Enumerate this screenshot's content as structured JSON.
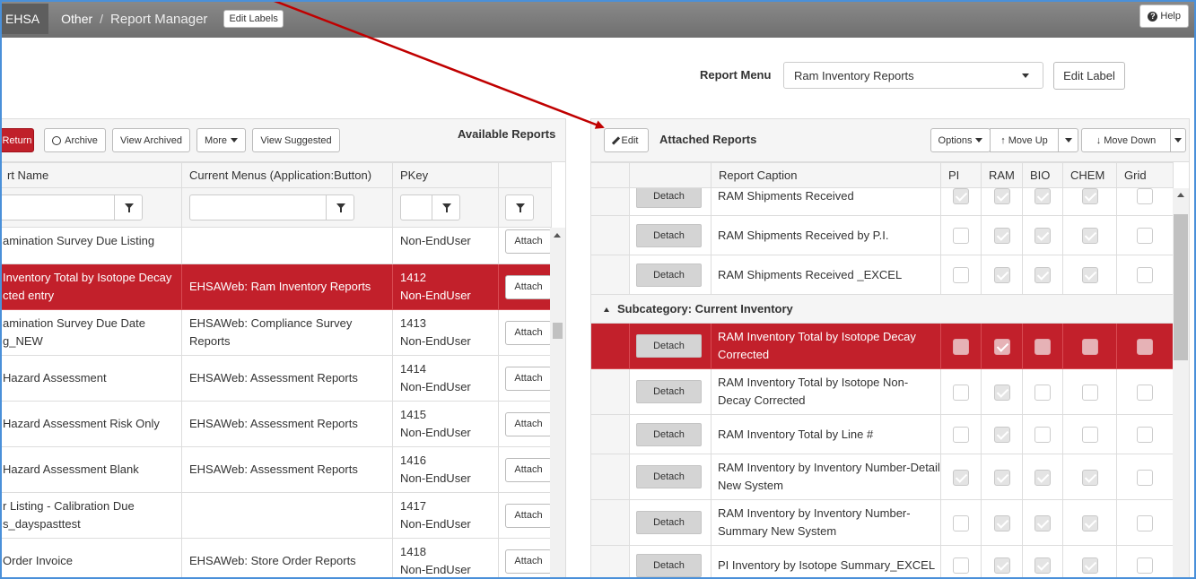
{
  "topbar": {
    "brand": "EHSA",
    "crumbs": [
      "Other",
      "/",
      "Report Manager"
    ],
    "edit_labels": "Edit Labels",
    "help": "Help"
  },
  "report_menu": {
    "label": "Report Menu",
    "selected": "Ram Inventory Reports",
    "edit_label": "Edit Label"
  },
  "left": {
    "buttons": {
      "return": "Return",
      "archive": "Archive",
      "view_archived": "View Archived",
      "more": "More",
      "view_suggested": "View Suggested"
    },
    "title": "Available Reports",
    "columns": [
      "rt Name",
      "Current Menus (Application:Button)",
      "PKey"
    ],
    "attach_label": "Attach",
    "rows": [
      {
        "name1": "amination Survey Due Listing",
        "name2": "",
        "menu1": "",
        "menu2": "",
        "pkey1": "",
        "pkey2": "Non-EndUser"
      },
      {
        "name1": "Inventory Total by Isotope Decay",
        "name2": "cted entry",
        "menu1": "EHSAWeb: Ram Inventory Reports",
        "menu2": "",
        "pkey1": "1412",
        "pkey2": "Non-EndUser"
      },
      {
        "name1": "amination Survey Due Date",
        "name2": "g_NEW",
        "menu1": "EHSAWeb: Compliance Survey",
        "menu2": "Reports",
        "pkey1": "1413",
        "pkey2": "Non-EndUser"
      },
      {
        "name1": "Hazard Assessment",
        "name2": "",
        "menu1": "EHSAWeb: Assessment Reports",
        "menu2": "",
        "pkey1": "1414",
        "pkey2": "Non-EndUser"
      },
      {
        "name1": "Hazard Assessment Risk Only",
        "name2": "",
        "menu1": "EHSAWeb: Assessment Reports",
        "menu2": "",
        "pkey1": "1415",
        "pkey2": "Non-EndUser"
      },
      {
        "name1": "Hazard Assessment Blank",
        "name2": "",
        "menu1": "EHSAWeb: Assessment Reports",
        "menu2": "",
        "pkey1": "1416",
        "pkey2": "Non-EndUser"
      },
      {
        "name1": "r Listing - Calibration Due",
        "name2": "s_dayspasttest",
        "menu1": "",
        "menu2": "",
        "pkey1": "1417",
        "pkey2": "Non-EndUser"
      },
      {
        "name1": "Order Invoice",
        "name2": "",
        "menu1": "EHSAWeb: Store Order Reports",
        "menu2": "",
        "pkey1": "1418",
        "pkey2": "Non-EndUser"
      }
    ]
  },
  "right": {
    "edit": "Edit",
    "title": "Attached Reports",
    "options": "Options",
    "move_up": "Move Up",
    "move_down": "Move Down",
    "columns": [
      "Report Caption",
      "PI",
      "RAM",
      "BIO",
      "CHEM",
      "Grid"
    ],
    "detach_label": "Detach",
    "subcategory": "Subcategory: Current Inventory",
    "rows_before": [
      {
        "cap1": "RAM Shipments Received",
        "cap2": "",
        "checks": [
          true,
          true,
          true,
          true,
          false
        ]
      },
      {
        "cap1": "RAM Shipments Received by P.I.",
        "cap2": "",
        "checks": [
          false,
          true,
          true,
          true,
          false
        ]
      },
      {
        "cap1": "RAM Shipments Received _EXCEL",
        "cap2": "",
        "checks": [
          false,
          true,
          true,
          true,
          false
        ]
      }
    ],
    "rows_after": [
      {
        "cap1": "RAM Inventory Total by Isotope Decay",
        "cap2": "Corrected",
        "checks": [
          false,
          true,
          false,
          false,
          false
        ]
      },
      {
        "cap1": "RAM Inventory Total by Isotope Non-",
        "cap2": "Decay Corrected",
        "checks": [
          false,
          true,
          false,
          false,
          false
        ]
      },
      {
        "cap1": "RAM Inventory Total by Line #",
        "cap2": "",
        "checks": [
          false,
          true,
          false,
          false,
          false
        ]
      },
      {
        "cap1": "RAM Inventory by Inventory Number-Detail",
        "cap2": "New System",
        "checks": [
          true,
          true,
          true,
          true,
          false
        ]
      },
      {
        "cap1": "RAM Inventory by Inventory Number-",
        "cap2": "Summary New System",
        "checks": [
          false,
          true,
          true,
          true,
          false
        ]
      },
      {
        "cap1": "PI Inventory by Isotope Summary_EXCEL",
        "cap2": "",
        "checks": [
          false,
          true,
          true,
          true,
          false
        ]
      }
    ]
  },
  "colors": {
    "selected_row": "#c2202b",
    "return_button": "#c0202a",
    "annotation_arrow": "#c00000"
  }
}
